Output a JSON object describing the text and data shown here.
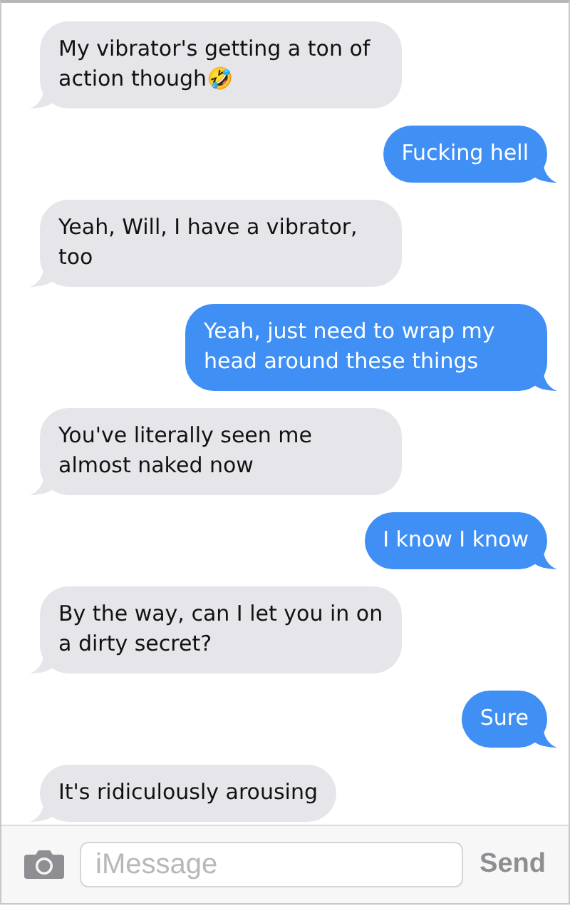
{
  "messages": [
    {
      "kind": "incoming",
      "text": "My vibrator's getting a ton of action though🤣"
    },
    {
      "kind": "outgoing",
      "text": "Fucking hell"
    },
    {
      "kind": "incoming",
      "text": "Yeah, Will, I have a vibrator, too"
    },
    {
      "kind": "outgoing",
      "text": "Yeah, just need to wrap my head around these things"
    },
    {
      "kind": "incoming",
      "text": "You've literally seen me almost naked now"
    },
    {
      "kind": "outgoing",
      "text": "I know I know"
    },
    {
      "kind": "incoming",
      "text": "By the way, can I let you in on a dirty secret?"
    },
    {
      "kind": "outgoing",
      "text": "Sure"
    },
    {
      "kind": "incoming",
      "text": "It's ridiculously arousing"
    }
  ],
  "composer": {
    "placeholder": "iMessage",
    "send": "Send"
  }
}
